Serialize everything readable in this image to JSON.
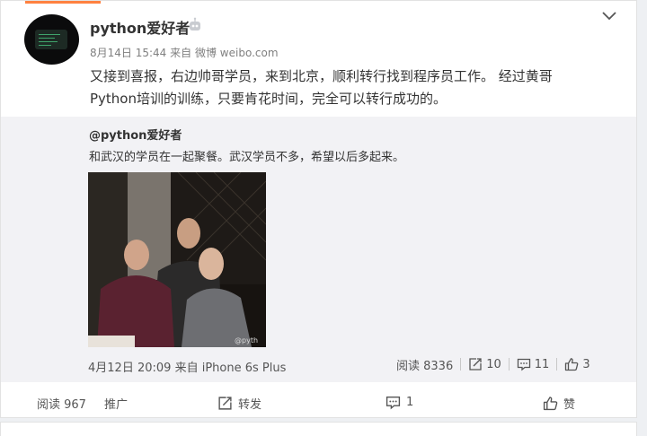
{
  "post": {
    "username": "python爱好者",
    "time": "8月14日 15:44",
    "from_label": "来自",
    "source": "微博 weibo.com",
    "text_line1": "又接到喜报，右边帅哥学员，来到北京，顺利转行找到程序员工作。 经过黄哥",
    "text_line2": "Python培训的训练，只要肯花时间，完全可以转行成功的。"
  },
  "repost": {
    "username": "@python爱好者",
    "text": "和武汉的学员在一起聚餐。武汉学员不多，希望以后多起来。",
    "photo_watermark": "@pyth",
    "time": "4月12日 20:09",
    "from_label": "来自",
    "source": "iPhone 6s Plus",
    "reads": "阅读 8336",
    "reposts": "10",
    "comments": "11",
    "likes": "3"
  },
  "footer": {
    "reads": "阅读 967",
    "promote": "推广",
    "repost": "转发",
    "comments": "1",
    "like": "赞"
  },
  "icons": {
    "avatar": "avatar-image",
    "vip": "robot-badge-icon",
    "more": "chevron-down-icon",
    "repost": "repost-icon",
    "comment": "comment-icon",
    "like": "thumbs-up-icon"
  },
  "colors": {
    "accent": "#ff8140",
    "text": "#333333",
    "meta": "#808080",
    "repost_bg": "#f2f2f5"
  }
}
